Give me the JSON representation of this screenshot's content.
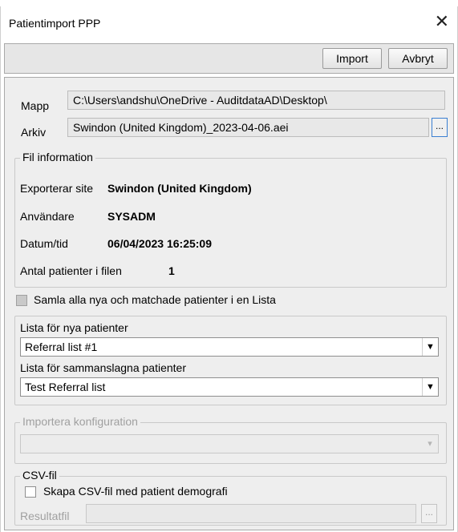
{
  "window": {
    "title": "Patientimport PPP"
  },
  "toolbar": {
    "import_label": "Import",
    "cancel_label": "Avbryt"
  },
  "folder": {
    "label": "Mapp",
    "value": "C:\\Users\\andshu\\OneDrive - AuditdataAD\\Desktop\\"
  },
  "archive": {
    "label": "Arkiv",
    "value": "Swindon (United Kingdom)_2023-04-06.aei",
    "browse_label": "..."
  },
  "file_info": {
    "title": "Fil information",
    "site_label": "Exporterar site",
    "site_value": "Swindon (United Kingdom)",
    "user_label": "Användare",
    "user_value": "SYSADM",
    "datetime_label": "Datum/tid",
    "datetime_value": "06/04/2023 16:25:09",
    "count_label": "Antal patienter i filen",
    "count_value": "1"
  },
  "collect": {
    "label": "Samla alla nya och matchade patienter i en Lista"
  },
  "lists": {
    "new_label": "Lista för nya patienter",
    "new_value": "Referral list #1",
    "merged_label": "Lista för sammanslagna patienter",
    "merged_value": "Test Referral list"
  },
  "import_config": {
    "title": "Importera konfiguration",
    "value": ""
  },
  "csv": {
    "title": "CSV-fil",
    "checkbox_label": "Skapa CSV-fil med patient demografi",
    "result_label": "Resultatfil",
    "result_value": "",
    "browse_label": "..."
  },
  "icons": {
    "close": "close-icon",
    "dropdown": "chevron-down-icon"
  }
}
